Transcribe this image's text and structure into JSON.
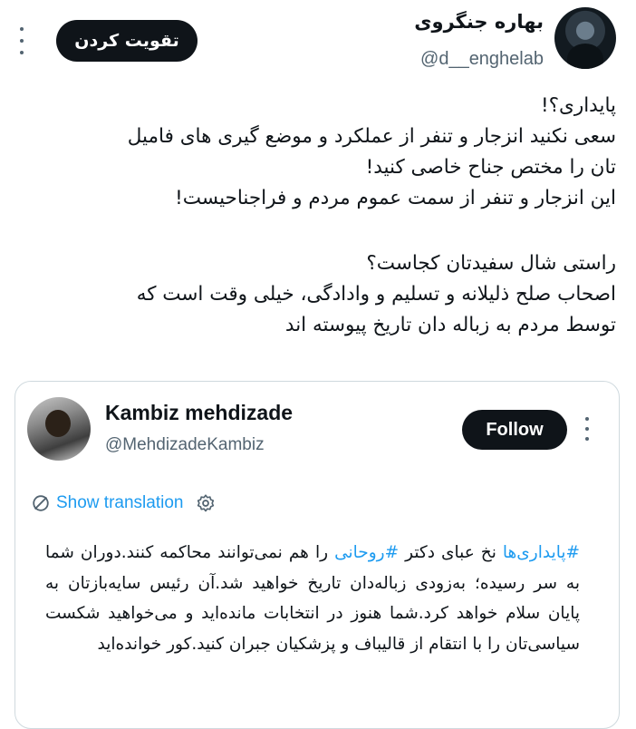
{
  "post": {
    "author_name": "بهاره جنگروی",
    "handle": "@d__enghelab",
    "boost_label": "تقویت کردن",
    "paragraph1": [
      "پایداری؟!",
      "سعی نکنید انزجار و تنفر از عملکرد و موضع گیری های فامیل",
      "تان را مختص جناح خاصی کنید!",
      "این انزجار و تنفر از سمت عموم مردم و فراجناحیست!"
    ],
    "paragraph2": [
      "راستی شال سفیدتان کجاست؟",
      "اصحاب صلح ذلیلانه و تسلیم و وادادگی، خیلی وقت است که",
      "توسط مردم به زباله دان تاریخ پیوسته اند"
    ]
  },
  "quote": {
    "author_name": "Kambiz mehdizade",
    "handle": "@MehdizadeKambiz",
    "follow_label": "Follow",
    "translate_label": "Show translation",
    "hashtag1": "#پایداری‌ها",
    "text_a": " نخ عبای دکتر ",
    "hashtag2": "#روحانی",
    "text_b": " را هم نمی‌توانند محاکمه کنند.دوران شما به سر رسیده؛ به‌زودی زباله‌دان تاریخ خواهید شد.آن رئیس سایه‌بازتان به پایان سلام خواهد کرد.شما هنوز در انتخابات مانده‌اید و می‌خواهید شکست سیاسی‌تان را با انتقام از قالیباف و پزشکیان جبران کنید.کور خوانده‌اید"
  },
  "colors": {
    "link": "#1d9bf0",
    "text": "#0f1419",
    "muted": "#536471",
    "button_bg": "#0f1419",
    "border": "#cfd9de"
  },
  "icons": [
    "more-icon",
    "globe-icon",
    "gear-icon"
  ]
}
